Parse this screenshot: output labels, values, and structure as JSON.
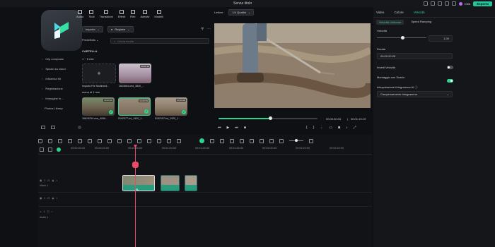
{
  "window": {
    "title": "Senza titolo"
  },
  "header": {
    "credits": "1066",
    "export_label": "Esporta"
  },
  "topnav": [
    "Audio",
    "Titoli",
    "Transizioni",
    "Effetti",
    "Filtri",
    "Adesivi",
    "Modelli"
  ],
  "sidebar": {
    "items": [
      "Clip composta",
      "Spazio su cloud",
      "Influenza Kit",
      "Registrazione",
      "Immagine in ...",
      "Photos Library"
    ]
  },
  "media": {
    "import_label": "Importa",
    "record_label": "Registra",
    "preset_label": "Predefinito",
    "search_placeholder": "Cerca media",
    "folder_label": "CARTELLA",
    "group1": "1 ~ 5 min",
    "group2": "meno di 1 min",
    "items": [
      {
        "caption": "Importa File Multimedi...",
        "duration": ""
      },
      {
        "caption": "2603664-uhd_3840_...",
        "duration": "00:00:18"
      },
      {
        "caption": "16619234-uhd_4096...",
        "duration": "00:00:09"
      },
      {
        "caption": "5192077-hd_1920_1...",
        "duration": "00:00:05"
      },
      {
        "caption": "5192157-hd_1920_1...",
        "duration": "00:00:08"
      }
    ]
  },
  "player": {
    "label": "Lettore",
    "quality": "1/4 Qualità",
    "time_current": "00:00:30:04",
    "time_total": "00:01:19:19",
    "progress": 0.52
  },
  "right_panel": {
    "tabs": [
      "Video",
      "Colore",
      "Velocità"
    ],
    "active_tab": "Velocità",
    "subtabs": [
      "Velocità Uniforme",
      "Speed Ramping"
    ],
    "velocity_label": "Velocità",
    "velocity_value": "1.00",
    "duration_label": "Durata",
    "duration_value": "00:00:20:05",
    "reverse_label": "Inverti Velocità",
    "ripple_label": "Montaggio con Scarto",
    "interp_label": "Interpolazione fotogramma AI",
    "interp_value": "Campionamento fotogramma"
  },
  "timeline": {
    "ticks": [
      "00:00:00:00",
      "00:00:20:00",
      "00:00:40:00",
      "00:01:00:00",
      "00:01:20:00",
      "00:01:40:00",
      "00:02:00:00",
      "00:02:20:00",
      "00:02:40:00"
    ],
    "track_labels": [
      "Video 1",
      "Audio 1"
    ],
    "track_numbers": [
      "2",
      "1",
      "1"
    ]
  },
  "colors": {
    "accent": "#2fd18f",
    "playhead": "#e94a67",
    "export": "#25c49b"
  }
}
